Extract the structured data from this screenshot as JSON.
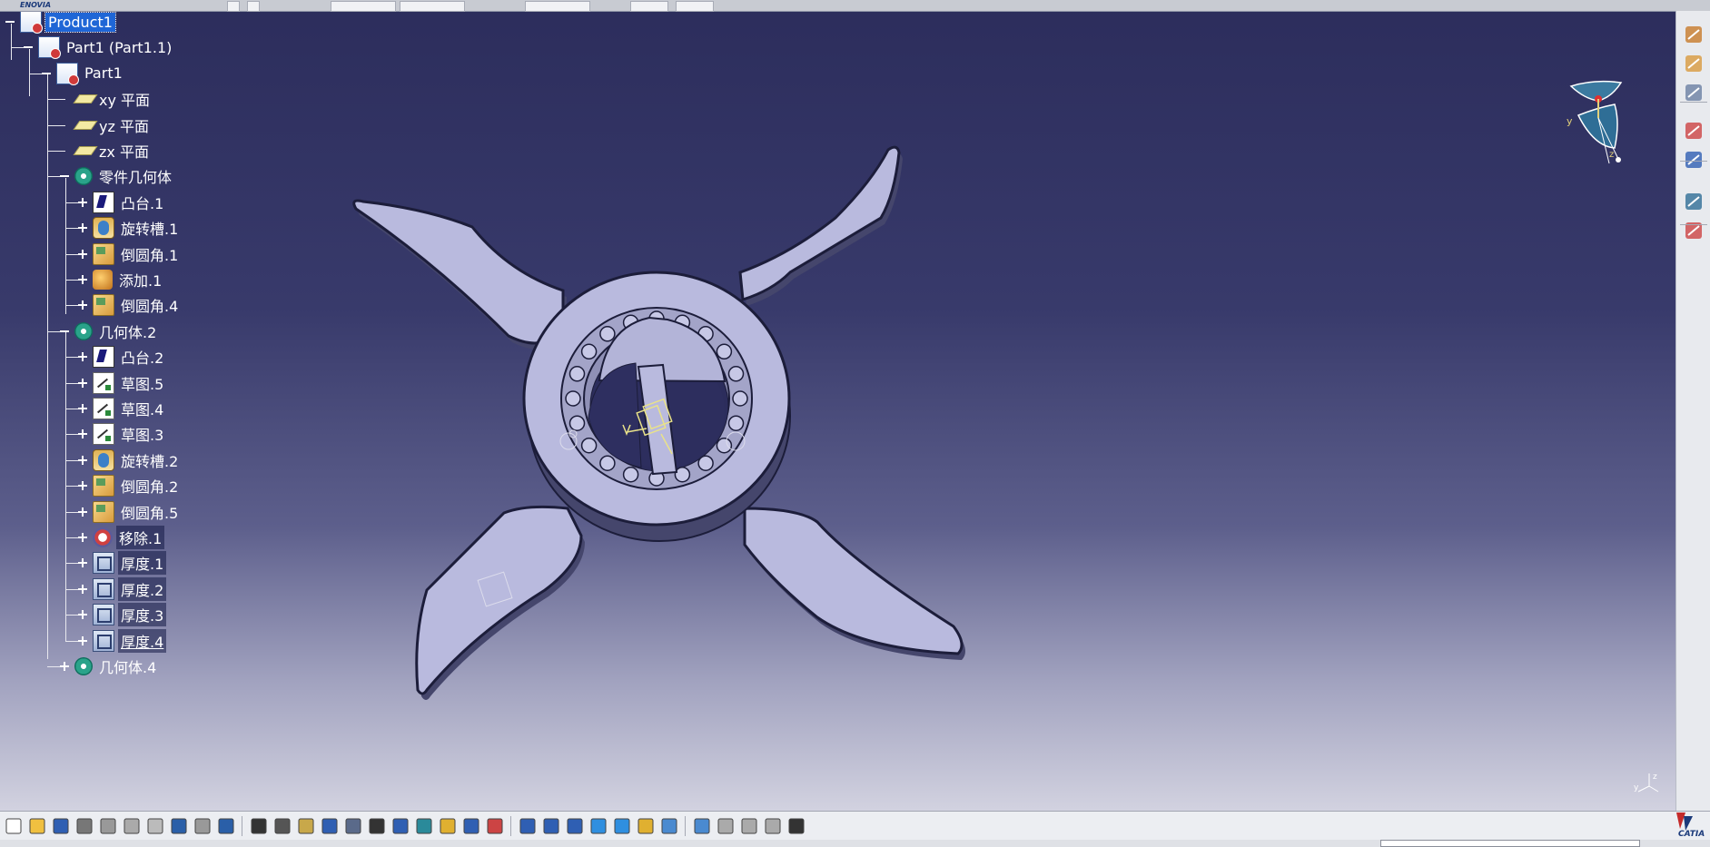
{
  "app": {
    "brand": "ENOVIA",
    "logo_text": "CATIA"
  },
  "tree": {
    "nodes": [
      {
        "label": "Product1",
        "icon": "product-icon",
        "selected": true
      },
      {
        "label": "Part1 (Part1.1)",
        "icon": "part-instance-icon"
      },
      {
        "label": "Part1",
        "icon": "part-icon"
      },
      {
        "label": "xy 平面",
        "icon": "plane-icon"
      },
      {
        "label": "yz 平面",
        "icon": "plane-icon"
      },
      {
        "label": "zx 平面",
        "icon": "plane-icon"
      },
      {
        "label": "零件几何体",
        "icon": "body-icon"
      },
      {
        "label": "凸台.1",
        "icon": "pad-icon"
      },
      {
        "label": "旋转槽.1",
        "icon": "groove-icon"
      },
      {
        "label": "倒圆角.1",
        "icon": "fillet-icon"
      },
      {
        "label": "添加.1",
        "icon": "add-icon"
      },
      {
        "label": "倒圆角.4",
        "icon": "fillet-icon"
      },
      {
        "label": "几何体.2",
        "icon": "body-icon"
      },
      {
        "label": "凸台.2",
        "icon": "pad-icon"
      },
      {
        "label": "草图.5",
        "icon": "sketch-icon"
      },
      {
        "label": "草图.4",
        "icon": "sketch-icon"
      },
      {
        "label": "草图.3",
        "icon": "sketch-icon"
      },
      {
        "label": "旋转槽.2",
        "icon": "groove-icon"
      },
      {
        "label": "倒圆角.2",
        "icon": "fillet-icon"
      },
      {
        "label": "倒圆角.5",
        "icon": "fillet-icon"
      },
      {
        "label": "移除.1",
        "icon": "remove-icon"
      },
      {
        "label": "厚度.1",
        "icon": "thickness-icon"
      },
      {
        "label": "厚度.2",
        "icon": "thickness-icon"
      },
      {
        "label": "厚度.3",
        "icon": "thickness-icon"
      },
      {
        "label": "厚度.4",
        "icon": "thickness-icon"
      },
      {
        "label": "几何体.4",
        "icon": "body-icon"
      }
    ]
  },
  "compass": {
    "axis_y": "y",
    "axis_z": "z"
  },
  "mini_axis": {
    "axis_y": "y",
    "axis_z": "z"
  },
  "colors": {
    "selection": "#1f66d6",
    "part_face": "#b9bade",
    "part_edge": "#1c1d3a"
  },
  "bottom_toolbar": [
    "new-icon",
    "open-icon",
    "save-icon",
    "print-icon",
    "cut-icon",
    "copy-icon",
    "paste-icon",
    "undo-icon",
    "redo-icon",
    "whats-this-icon",
    "formula-icon",
    "comment-icon",
    "light-icon",
    "table-icon",
    "tree-icon",
    "lock-icon",
    "measure-icon",
    "fly-icon",
    "fit-all-icon",
    "pan-icon",
    "rotate-icon",
    "zoom-in-icon",
    "zoom-out-icon",
    "normal-view-icon",
    "multi-view-icon",
    "iso-view-icon",
    "render-style-icon",
    "hide-show-icon",
    "swap-space-icon",
    "sketch-analysis-icon",
    "constraint-icon",
    "constraint-def-icon",
    "capture-icon"
  ],
  "right_toolbar": [
    "sketcher-icon",
    "select-icon",
    "knowledge-icon",
    "analysis-icon",
    "view-icon",
    "eye-icon",
    "visibility-icon"
  ]
}
